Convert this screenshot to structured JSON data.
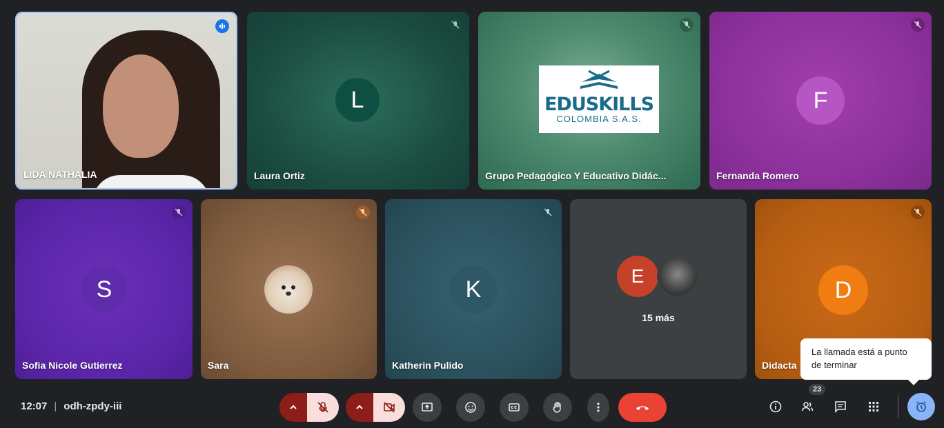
{
  "tiles": [
    {
      "name": "LIDA NATHALIA"
    },
    {
      "name": "Laura Ortiz",
      "initial": "L"
    },
    {
      "name": "Grupo Pedagógico Y Educativo Didác..."
    },
    {
      "name": "Fernanda Romero",
      "initial": "F"
    },
    {
      "name": "Sofia Nicole Gutierrez",
      "initial": "S"
    },
    {
      "name": "Sara"
    },
    {
      "name": "Katherin Pulido",
      "initial": "K"
    },
    {
      "initial": "E",
      "more": "15 más"
    },
    {
      "name": "Didacta",
      "initial": "D"
    }
  ],
  "logo": {
    "brand": "EDUSKILLS",
    "sub": "COLOMBIA S.A.S."
  },
  "meeting": {
    "time": "12:07",
    "separator": "|",
    "code": "odh-zpdy-iii"
  },
  "participants_count": "23",
  "tooltip": {
    "line1": "La llamada está a punto",
    "line2": "de terminar"
  },
  "colors": {
    "end_call": "#ea4335",
    "muted_bg": "#f9dedc",
    "muted_side": "#8c1d18",
    "control_bg": "#3c4043",
    "timer_accent": "#8ab4f8"
  }
}
